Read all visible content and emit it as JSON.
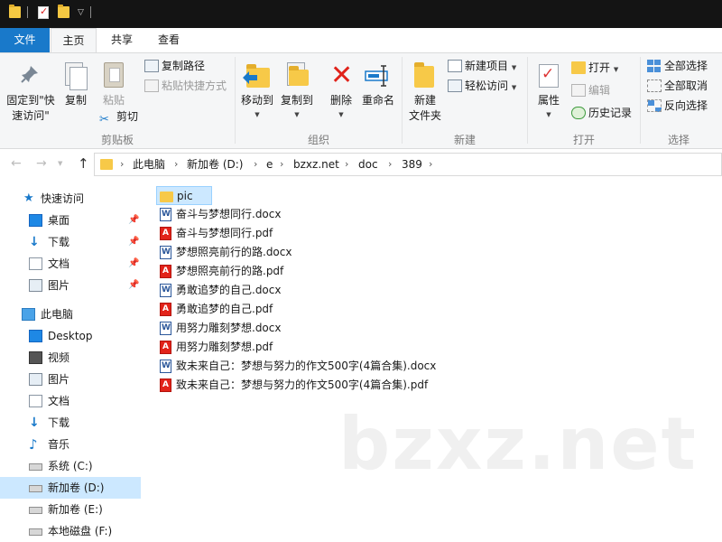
{
  "tabs": {
    "file": "文件",
    "home": "主页",
    "share": "共享",
    "view": "查看"
  },
  "ribbon": {
    "clipboard": {
      "label": "剪贴板",
      "pin_line1": "固定到\"快",
      "pin_line2": "速访问\"",
      "copy": "复制",
      "paste": "粘贴",
      "copy_path": "复制路径",
      "paste_shortcut": "粘贴快捷方式",
      "cut": "剪切"
    },
    "organize": {
      "label": "组织",
      "move_to": "移动到",
      "copy_to": "复制到",
      "delete": "删除",
      "rename": "重命名"
    },
    "new": {
      "label": "新建",
      "new_folder_line1": "新建",
      "new_folder_line2": "文件夹",
      "new_item": "新建项目",
      "easy_access": "轻松访问"
    },
    "open": {
      "label": "打开",
      "properties": "属性",
      "open": "打开",
      "edit": "编辑",
      "history": "历史记录"
    },
    "select": {
      "label": "选择",
      "select_all": "全部选择",
      "select_none": "全部取消",
      "invert": "反向选择"
    }
  },
  "address": {
    "crumbs": [
      "此电脑",
      "新加卷 (D:)",
      "e",
      "bzxz.net",
      "doc",
      "389"
    ]
  },
  "nav": {
    "quick_access": "快速访问",
    "qa_items": [
      "桌面",
      "下载",
      "文档",
      "图片"
    ],
    "this_pc": "此电脑",
    "pc_items": [
      "Desktop",
      "视频",
      "图片",
      "文档",
      "下载",
      "音乐",
      "系统 (C:)",
      "新加卷 (D:)",
      "新加卷 (E:)",
      "本地磁盘 (F:)"
    ]
  },
  "files": [
    {
      "name": "pic",
      "type": "folder"
    },
    {
      "name": "奋斗与梦想同行.docx",
      "type": "docx"
    },
    {
      "name": "奋斗与梦想同行.pdf",
      "type": "pdf"
    },
    {
      "name": "梦想照亮前行的路.docx",
      "type": "docx"
    },
    {
      "name": "梦想照亮前行的路.pdf",
      "type": "pdf"
    },
    {
      "name": "勇敢追梦的自己.docx",
      "type": "docx"
    },
    {
      "name": "勇敢追梦的自己.pdf",
      "type": "pdf"
    },
    {
      "name": "用努力雕刻梦想.docx",
      "type": "docx"
    },
    {
      "name": "用努力雕刻梦想.pdf",
      "type": "pdf"
    },
    {
      "name": "致未来自己：梦想与努力的作文500字(4篇合集).docx",
      "type": "docx"
    },
    {
      "name": "致未来自己：梦想与努力的作文500字(4篇合集).pdf",
      "type": "pdf"
    }
  ],
  "watermark": "bzxz.net",
  "colors": {
    "accent": "#1979ca",
    "selection": "#cce8ff",
    "pdf": "#e2231a",
    "word": "#2b579a",
    "folder": "#f7c948"
  }
}
